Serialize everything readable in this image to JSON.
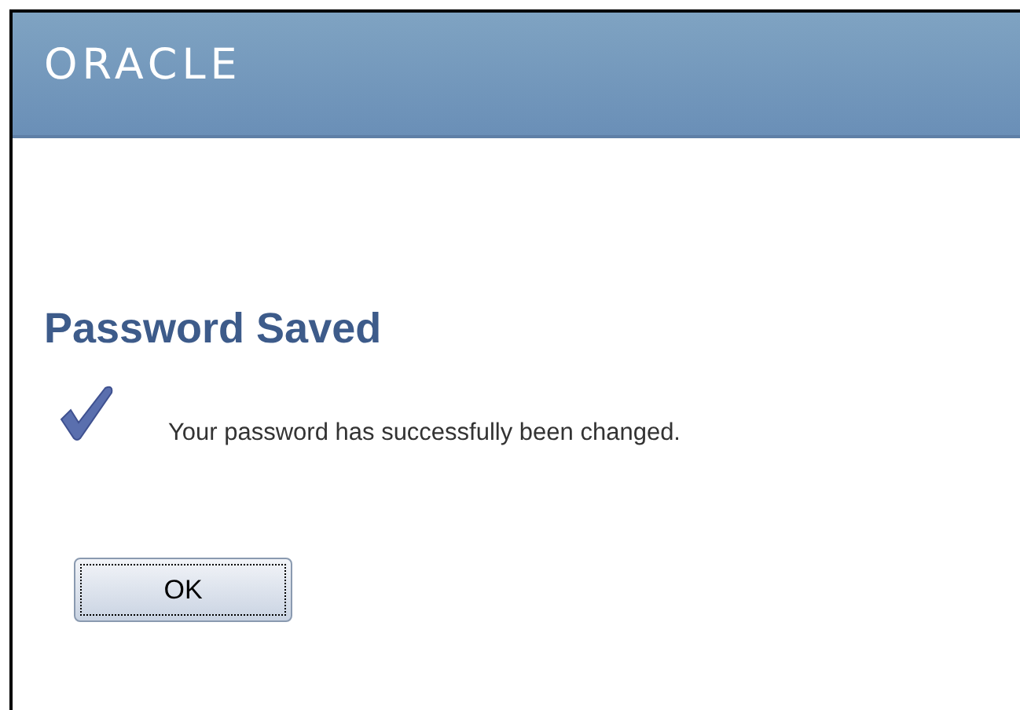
{
  "header": {
    "logo": "ORACLE"
  },
  "page": {
    "title": "Password Saved",
    "message": "Your password has successfully been changed."
  },
  "buttons": [
    "OK"
  ]
}
